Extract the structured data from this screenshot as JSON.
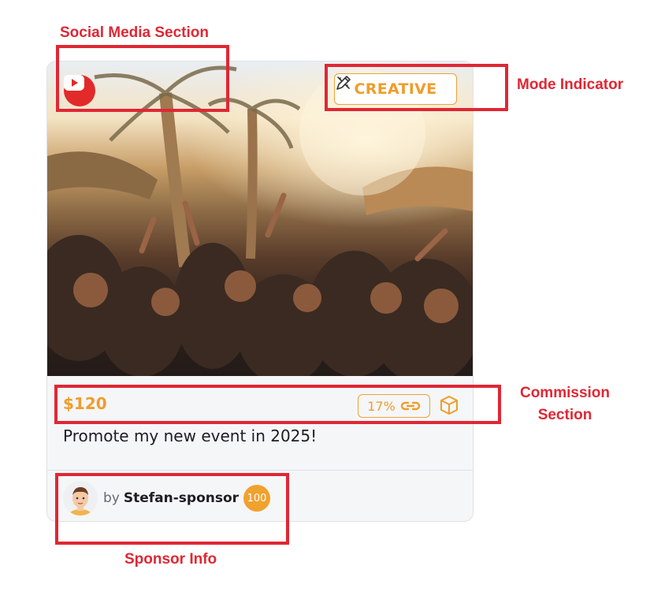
{
  "annotations": {
    "social_media": "Social Media Section",
    "mode": "Mode Indicator",
    "commission_line1": "Commission",
    "commission_line2": "Section",
    "sponsor": "Sponsor Info"
  },
  "card": {
    "social_icon": "youtube-icon",
    "mode_label": "CREATIVE",
    "mode_icon": "pencil-ruler-icon",
    "price": "$120",
    "commission_percent": "17%",
    "commission_icon": "link-icon",
    "extra_icon": "box-icon",
    "title": "Promote my new event in 2025!",
    "sponsor": {
      "prefix": "by",
      "name": "Stefan-sponsor",
      "score": "100"
    }
  },
  "colors": {
    "accent": "#ef9d2b",
    "annotation": "#e02734",
    "youtube": "#e22a2a"
  }
}
